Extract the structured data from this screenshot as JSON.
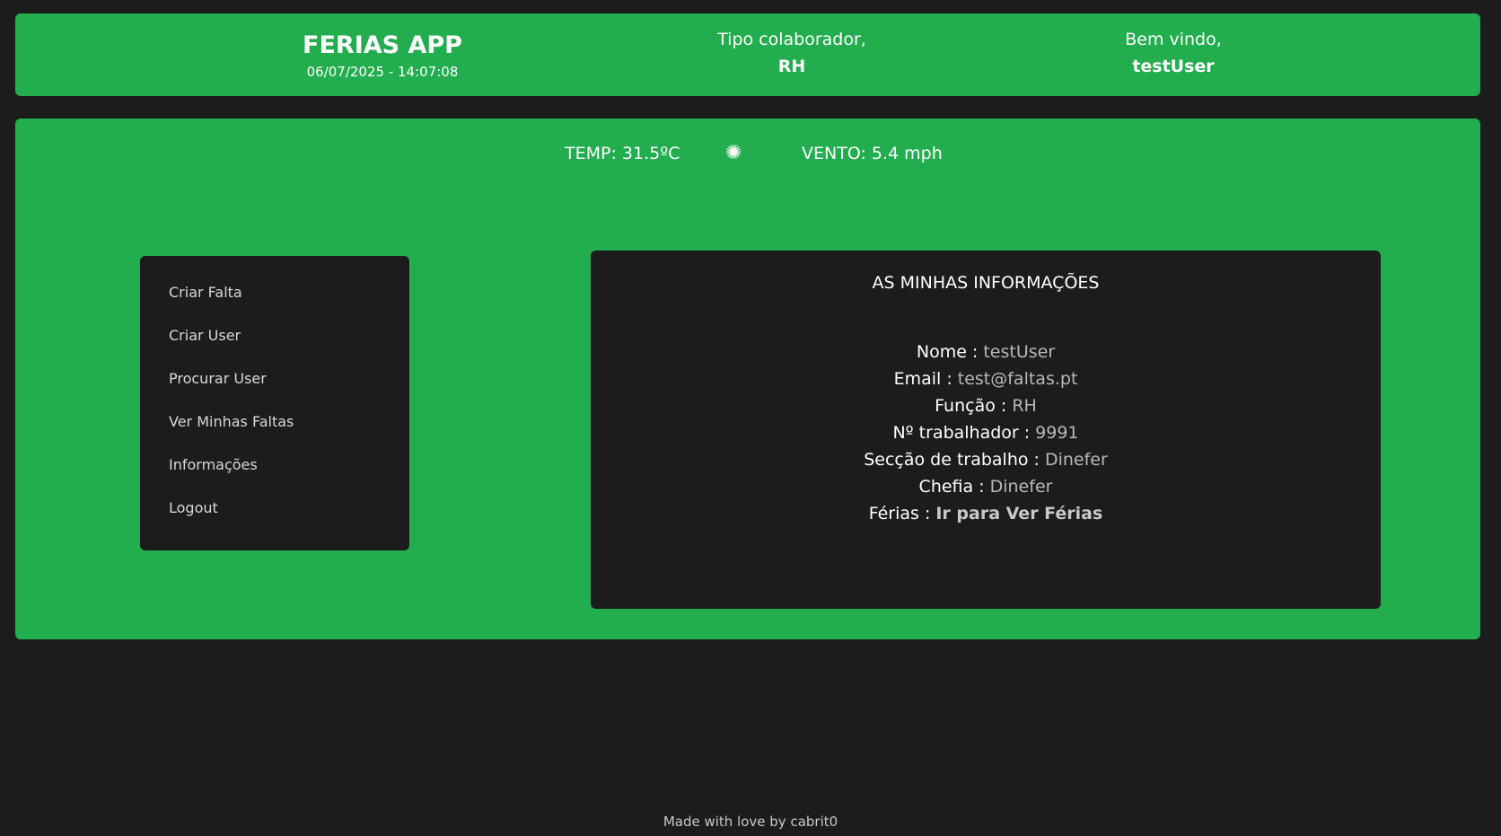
{
  "header": {
    "app_title": "FERIAS APP",
    "datetime": "06/07/2025 - 14:07:08",
    "tipo_label": "Tipo colaborador,",
    "tipo_value": "RH",
    "welcome_label": "Bem vindo,",
    "welcome_user": "testUser"
  },
  "weather": {
    "temp": "TEMP: 31.5ºC",
    "icon": "sun-icon",
    "icon_glyph": "✺",
    "wind": "VENTO: 5.4 mph"
  },
  "sidebar": {
    "items": [
      {
        "label": "Criar Falta"
      },
      {
        "label": "Criar User"
      },
      {
        "label": "Procurar User"
      },
      {
        "label": "Ver Minhas Faltas"
      },
      {
        "label": "Informações"
      },
      {
        "label": "Logout"
      }
    ]
  },
  "info": {
    "title": "AS MINHAS INFORMAÇÕES",
    "rows": [
      {
        "key": "Nome :",
        "value": "testUser"
      },
      {
        "key": "Email :",
        "value": "test@faltas.pt"
      },
      {
        "key": "Função :",
        "value": "RH"
      },
      {
        "key": "Nº trabalhador :",
        "value": "9991"
      },
      {
        "key": "Secção de trabalho :",
        "value": "Dinefer"
      },
      {
        "key": "Chefia :",
        "value": "Dinefer"
      },
      {
        "key": "Férias :",
        "value": "Ir para Ver Férias"
      }
    ]
  },
  "footer": {
    "text": "Made with love by cabrit0"
  },
  "colors": {
    "accent": "#22ad4f",
    "background": "#1b1c1b"
  }
}
